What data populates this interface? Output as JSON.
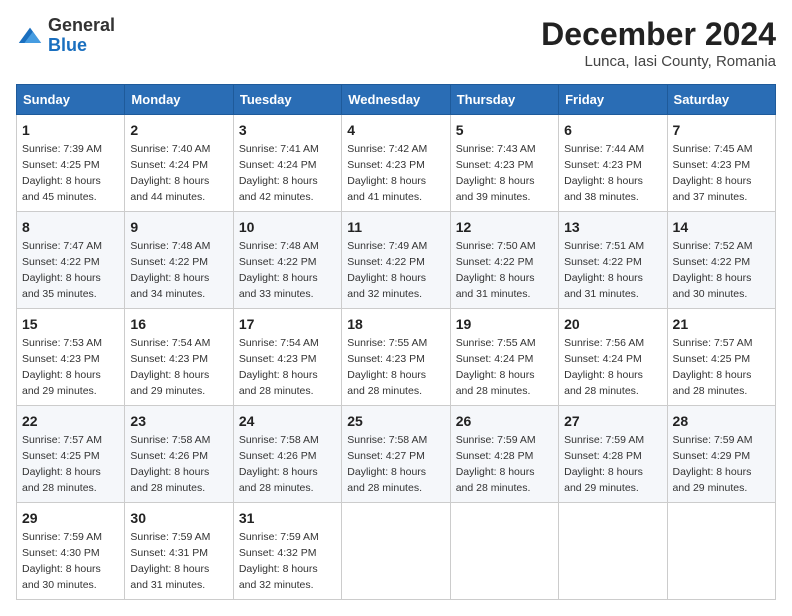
{
  "header": {
    "logo_general": "General",
    "logo_blue": "Blue",
    "month_title": "December 2024",
    "location": "Lunca, Iasi County, Romania"
  },
  "weekdays": [
    "Sunday",
    "Monday",
    "Tuesday",
    "Wednesday",
    "Thursday",
    "Friday",
    "Saturday"
  ],
  "weeks": [
    [
      {
        "day": "1",
        "sunrise": "7:39 AM",
        "sunset": "4:25 PM",
        "daylight": "8 hours and 45 minutes."
      },
      {
        "day": "2",
        "sunrise": "7:40 AM",
        "sunset": "4:24 PM",
        "daylight": "8 hours and 44 minutes."
      },
      {
        "day": "3",
        "sunrise": "7:41 AM",
        "sunset": "4:24 PM",
        "daylight": "8 hours and 42 minutes."
      },
      {
        "day": "4",
        "sunrise": "7:42 AM",
        "sunset": "4:23 PM",
        "daylight": "8 hours and 41 minutes."
      },
      {
        "day": "5",
        "sunrise": "7:43 AM",
        "sunset": "4:23 PM",
        "daylight": "8 hours and 39 minutes."
      },
      {
        "day": "6",
        "sunrise": "7:44 AM",
        "sunset": "4:23 PM",
        "daylight": "8 hours and 38 minutes."
      },
      {
        "day": "7",
        "sunrise": "7:45 AM",
        "sunset": "4:23 PM",
        "daylight": "8 hours and 37 minutes."
      }
    ],
    [
      {
        "day": "8",
        "sunrise": "7:47 AM",
        "sunset": "4:22 PM",
        "daylight": "8 hours and 35 minutes."
      },
      {
        "day": "9",
        "sunrise": "7:48 AM",
        "sunset": "4:22 PM",
        "daylight": "8 hours and 34 minutes."
      },
      {
        "day": "10",
        "sunrise": "7:48 AM",
        "sunset": "4:22 PM",
        "daylight": "8 hours and 33 minutes."
      },
      {
        "day": "11",
        "sunrise": "7:49 AM",
        "sunset": "4:22 PM",
        "daylight": "8 hours and 32 minutes."
      },
      {
        "day": "12",
        "sunrise": "7:50 AM",
        "sunset": "4:22 PM",
        "daylight": "8 hours and 31 minutes."
      },
      {
        "day": "13",
        "sunrise": "7:51 AM",
        "sunset": "4:22 PM",
        "daylight": "8 hours and 31 minutes."
      },
      {
        "day": "14",
        "sunrise": "7:52 AM",
        "sunset": "4:22 PM",
        "daylight": "8 hours and 30 minutes."
      }
    ],
    [
      {
        "day": "15",
        "sunrise": "7:53 AM",
        "sunset": "4:23 PM",
        "daylight": "8 hours and 29 minutes."
      },
      {
        "day": "16",
        "sunrise": "7:54 AM",
        "sunset": "4:23 PM",
        "daylight": "8 hours and 29 minutes."
      },
      {
        "day": "17",
        "sunrise": "7:54 AM",
        "sunset": "4:23 PM",
        "daylight": "8 hours and 28 minutes."
      },
      {
        "day": "18",
        "sunrise": "7:55 AM",
        "sunset": "4:23 PM",
        "daylight": "8 hours and 28 minutes."
      },
      {
        "day": "19",
        "sunrise": "7:55 AM",
        "sunset": "4:24 PM",
        "daylight": "8 hours and 28 minutes."
      },
      {
        "day": "20",
        "sunrise": "7:56 AM",
        "sunset": "4:24 PM",
        "daylight": "8 hours and 28 minutes."
      },
      {
        "day": "21",
        "sunrise": "7:57 AM",
        "sunset": "4:25 PM",
        "daylight": "8 hours and 28 minutes."
      }
    ],
    [
      {
        "day": "22",
        "sunrise": "7:57 AM",
        "sunset": "4:25 PM",
        "daylight": "8 hours and 28 minutes."
      },
      {
        "day": "23",
        "sunrise": "7:58 AM",
        "sunset": "4:26 PM",
        "daylight": "8 hours and 28 minutes."
      },
      {
        "day": "24",
        "sunrise": "7:58 AM",
        "sunset": "4:26 PM",
        "daylight": "8 hours and 28 minutes."
      },
      {
        "day": "25",
        "sunrise": "7:58 AM",
        "sunset": "4:27 PM",
        "daylight": "8 hours and 28 minutes."
      },
      {
        "day": "26",
        "sunrise": "7:59 AM",
        "sunset": "4:28 PM",
        "daylight": "8 hours and 28 minutes."
      },
      {
        "day": "27",
        "sunrise": "7:59 AM",
        "sunset": "4:28 PM",
        "daylight": "8 hours and 29 minutes."
      },
      {
        "day": "28",
        "sunrise": "7:59 AM",
        "sunset": "4:29 PM",
        "daylight": "8 hours and 29 minutes."
      }
    ],
    [
      {
        "day": "29",
        "sunrise": "7:59 AM",
        "sunset": "4:30 PM",
        "daylight": "8 hours and 30 minutes."
      },
      {
        "day": "30",
        "sunrise": "7:59 AM",
        "sunset": "4:31 PM",
        "daylight": "8 hours and 31 minutes."
      },
      {
        "day": "31",
        "sunrise": "7:59 AM",
        "sunset": "4:32 PM",
        "daylight": "8 hours and 32 minutes."
      },
      null,
      null,
      null,
      null
    ]
  ]
}
